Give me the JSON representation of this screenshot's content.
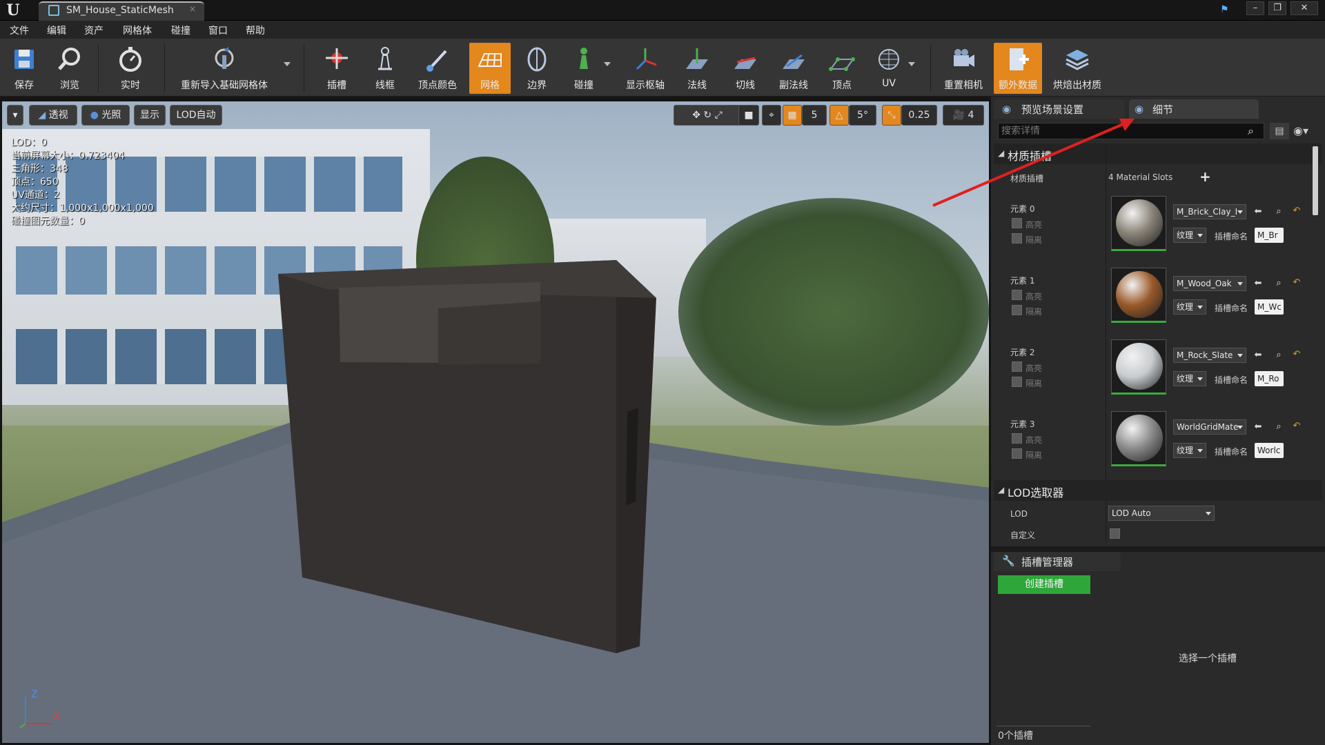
{
  "window": {
    "tab_title": "SM_House_StaticMesh",
    "tab_close": "×",
    "controls": [
      "–",
      "❐",
      "✕"
    ]
  },
  "menu": [
    "文件",
    "编辑",
    "资产",
    "网格体",
    "碰撞",
    "窗口",
    "帮助"
  ],
  "toolbar": {
    "save": "保存",
    "browse": "浏览",
    "realtime": "实时",
    "reimport": "重新导入基础网格体",
    "sockets": "插槽",
    "wireframe": "线框",
    "vertex_colors": "顶点颜色",
    "grid": "网格",
    "bounds": "边界",
    "collision": "碰撞",
    "pivot": "显示枢轴",
    "normals": "法线",
    "tangents": "切线",
    "binormals": "副法线",
    "vertices": "顶点",
    "uv": "UV",
    "reset_camera": "重置相机",
    "extra_data": "额外数据",
    "bake_materials": "烘焙出材质"
  },
  "viewport": {
    "perspective": "透视",
    "lit": "光照",
    "show": "显示",
    "lod": "LOD自动",
    "grid_snap": "5",
    "rotation_snap": "5°",
    "scale_snap": "0.25",
    "camera_speed": "4",
    "stats": [
      "LOD：0",
      "当前屏幕大小：0.723404",
      "三角形：348",
      "顶点：650",
      "UV通道：2",
      "大约尺寸：1,000x1,000x1,000",
      "碰撞图元数量：0"
    ],
    "axis_z": "Z",
    "axis_x": "X"
  },
  "panel": {
    "tab_preview": "预览场景设置",
    "tab_details": "细节",
    "search_placeholder": "搜索详情",
    "material_section": "材质插槽",
    "material_slots_label": "材质插槽",
    "material_slots_count": "4 Material Slots",
    "highlight": "高亮",
    "isolate": "隔离",
    "texture": "纹理",
    "slot_name_label": "插槽命名",
    "elements": [
      {
        "label": "元素 0",
        "material": "M_Brick_Clay_I",
        "slot_name": "M_Br",
        "color": "#8a8378"
      },
      {
        "label": "元素 1",
        "material": "M_Wood_Oak",
        "slot_name": "M_Wc",
        "color": "#9a5a2a"
      },
      {
        "label": "元素 2",
        "material": "M_Rock_Slate",
        "slot_name": "M_Ro",
        "color": "#c8cccf"
      },
      {
        "label": "元素 3",
        "material": "WorldGridMate",
        "slot_name": "Worlc",
        "color": "#8a8a8a"
      }
    ],
    "lod_section": "LOD选取器",
    "lod_label": "LOD",
    "lod_value": "LOD Auto",
    "custom_label": "自定义",
    "socket_tab": "插槽管理器",
    "create_socket": "创建插槽",
    "select_socket": "选择一个插槽",
    "socket_count": "0个插槽"
  }
}
